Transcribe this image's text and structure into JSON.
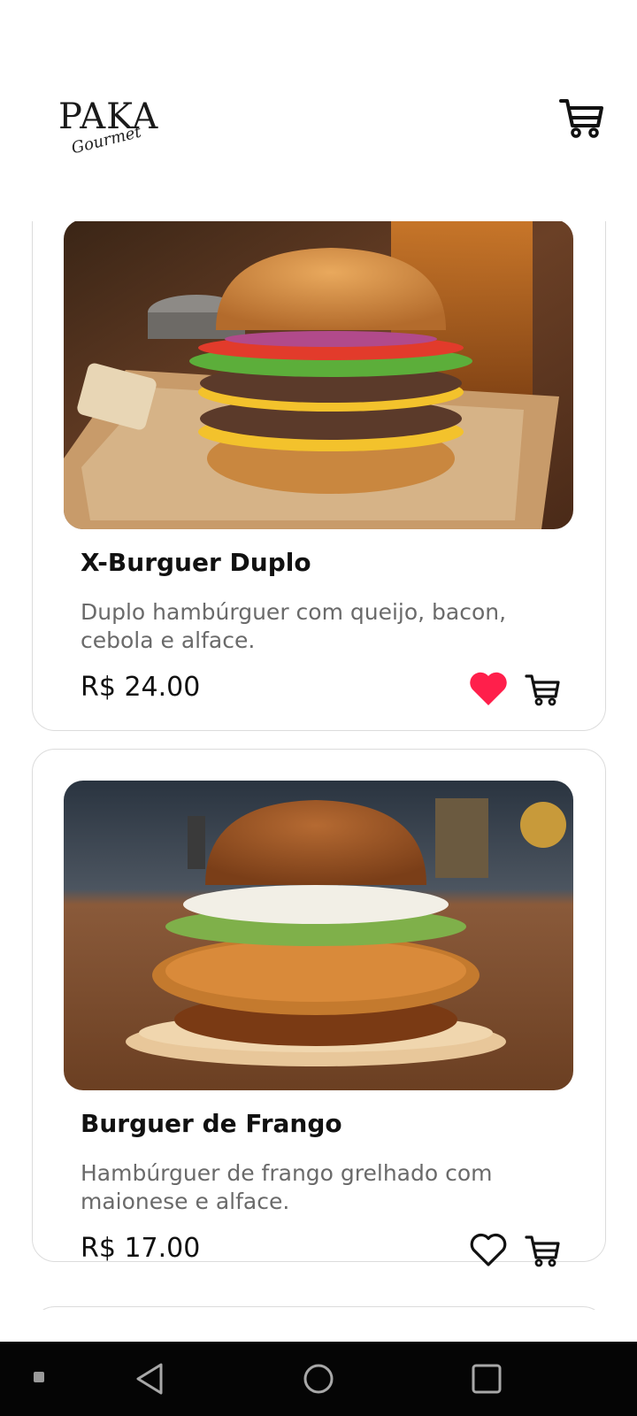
{
  "header": {
    "logo_main": "PAKA",
    "logo_sub": "Gourmet",
    "cart_icon": "shopping-cart-icon"
  },
  "products": [
    {
      "title": "X-Burguer Duplo",
      "description": "Duplo hambúrguer com queijo, bacon, cebola e alface.",
      "price": "R$ 24.00",
      "favorite": true,
      "favorite_icon": "heart-filled-icon",
      "cart_icon": "add-to-cart-icon",
      "image": "double-cheeseburger-photo"
    },
    {
      "title": "Burguer de Frango",
      "description": "Hambúrguer de frango grelhado com maionese e alface.",
      "price": "R$ 17.00",
      "favorite": false,
      "favorite_icon": "heart-outline-icon",
      "cart_icon": "add-to-cart-icon",
      "image": "fried-chicken-burger-photo"
    }
  ],
  "colors": {
    "favorite_active": "#ff1f4b",
    "card_border": "#dcdcdc",
    "description_text": "#6a6a6a",
    "navbar": "#050505"
  },
  "navbar": {
    "back_icon": "back-triangle-icon",
    "home_icon": "home-circle-icon",
    "recents_icon": "recents-square-icon"
  }
}
